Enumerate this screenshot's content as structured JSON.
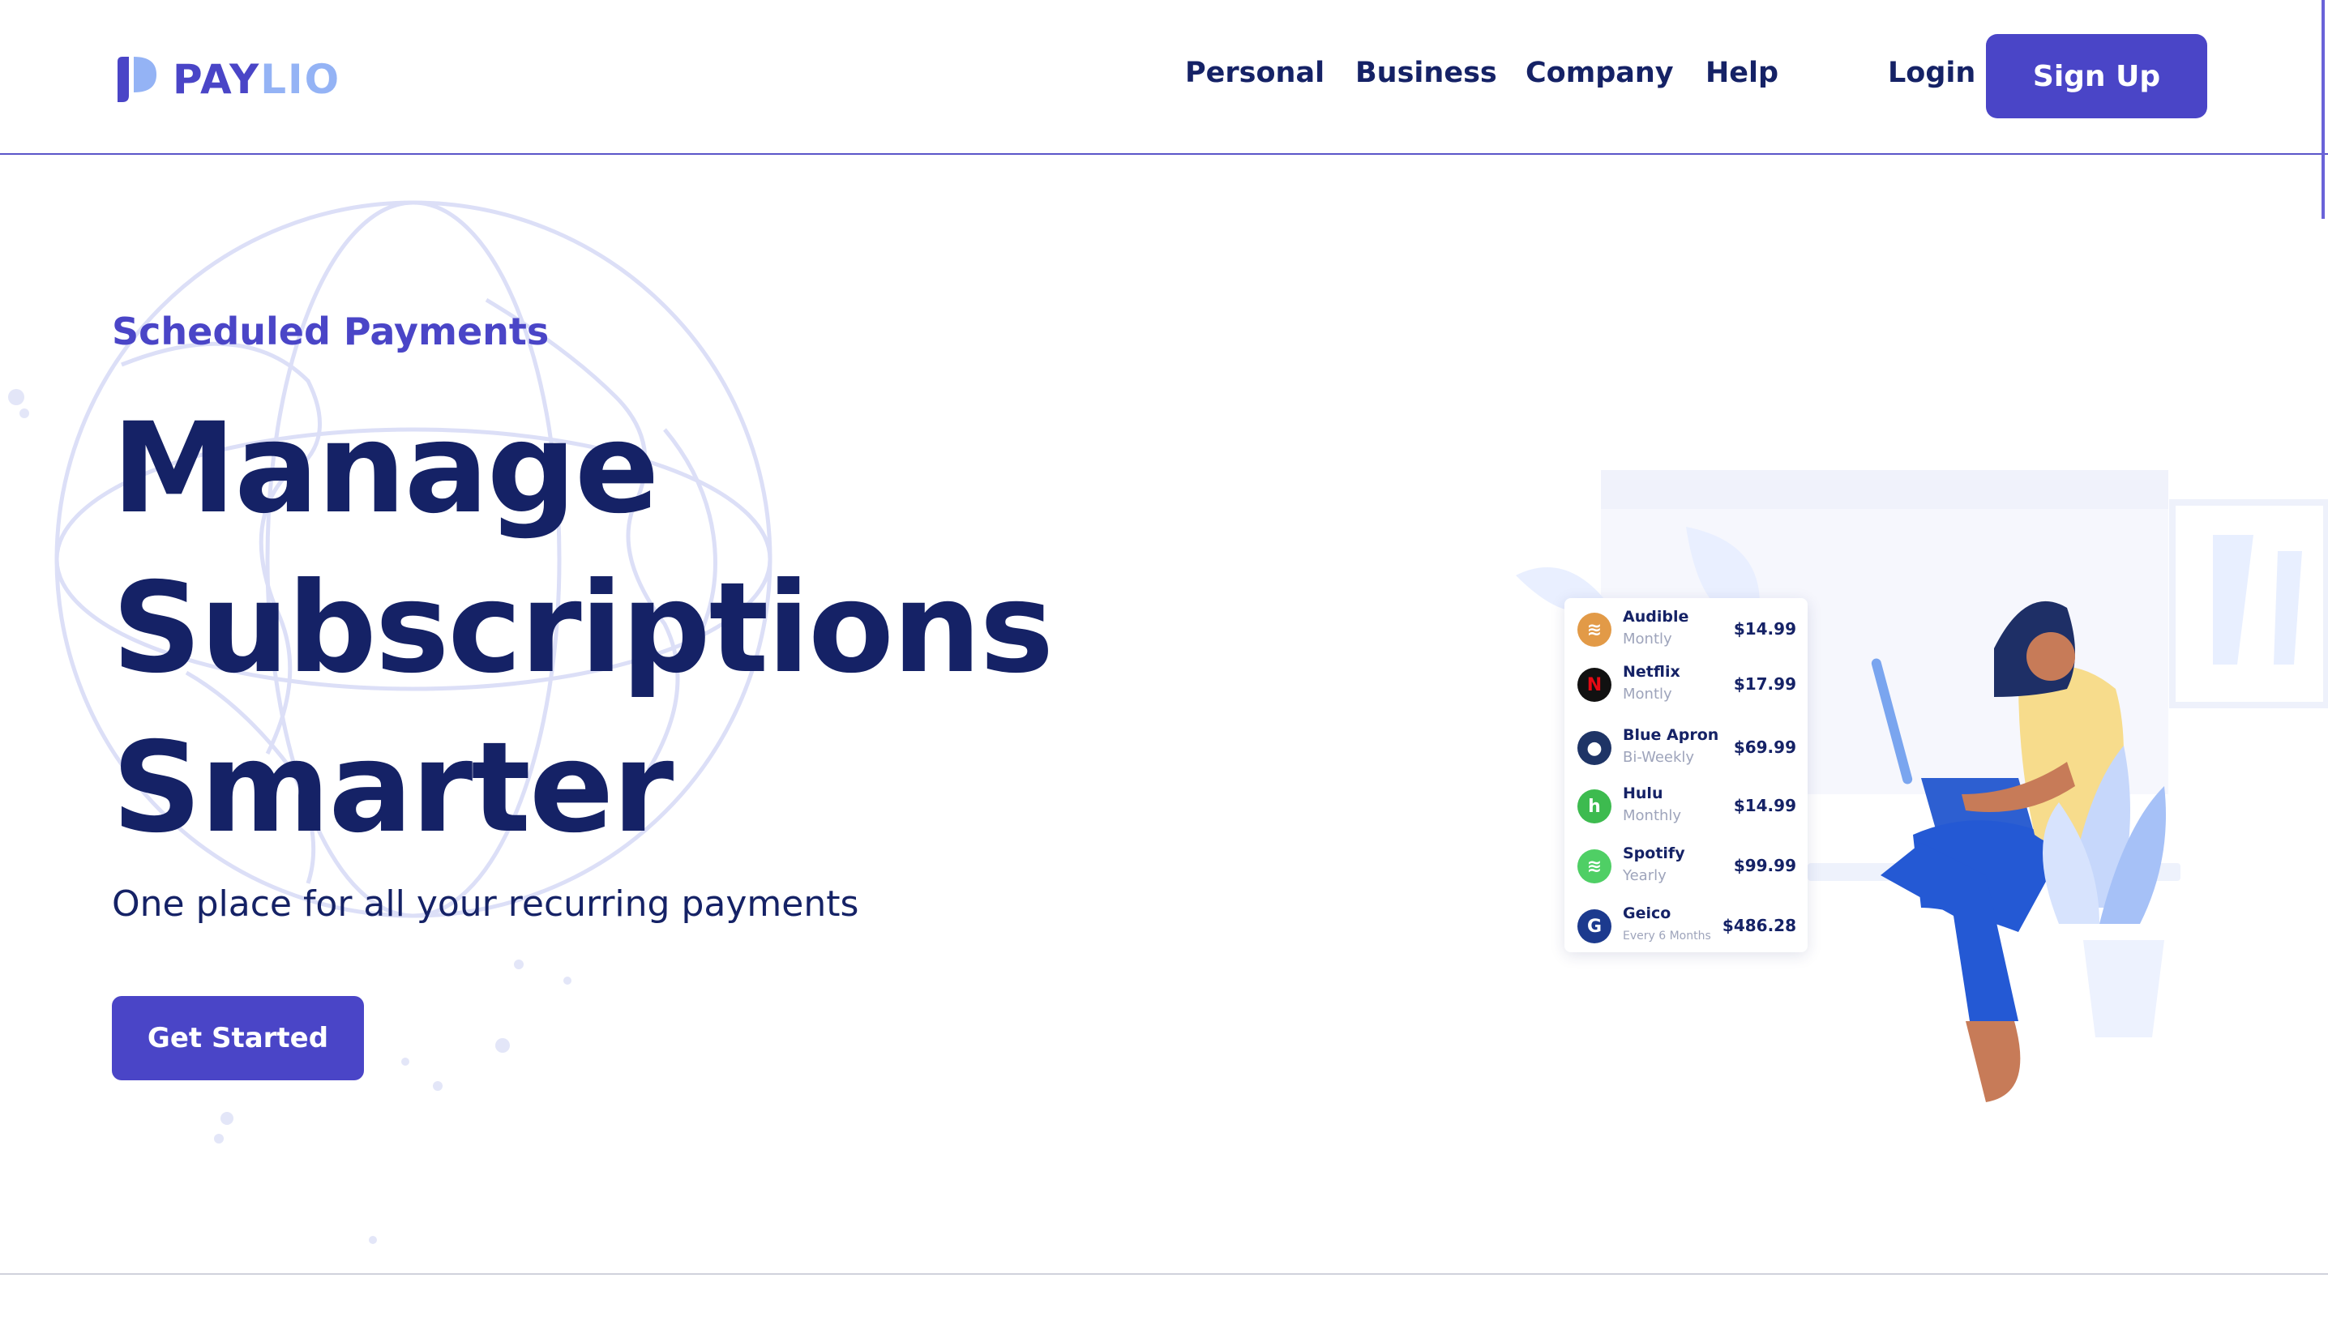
{
  "logo": {
    "part1": "PAY",
    "part2": "LIO"
  },
  "nav": {
    "personal": "Personal",
    "business": "Business",
    "company": "Company",
    "help": "Help",
    "login": "Login",
    "signup": "Sign Up"
  },
  "hero": {
    "eyebrow": "Scheduled Payments",
    "headline": [
      "Manage",
      "Subscriptions",
      "Smarter"
    ],
    "subhead": "One place for all your recurring payments",
    "cta": "Get Started"
  },
  "subscriptions": [
    {
      "name": "Audible",
      "frequency": "Montly",
      "price": "$14.99",
      "color": "#e29a47",
      "icon": "audible-icon",
      "glyph": "≋"
    },
    {
      "name": "Netflix",
      "frequency": "Montly",
      "price": "$17.99",
      "color": "#111111",
      "icon": "netflix-icon",
      "glyph": "N"
    },
    {
      "name": "Blue Apron",
      "frequency": "Bi-Weekly",
      "price": "$69.99",
      "color": "#1e3466",
      "icon": "blue-apron-icon",
      "glyph": "●"
    },
    {
      "name": "Hulu",
      "frequency": "Monthly",
      "price": "$14.99",
      "color": "#3dbb4f",
      "icon": "hulu-icon",
      "glyph": "h"
    },
    {
      "name": "Spotify",
      "frequency": "Yearly",
      "price": "$99.99",
      "color": "#4fcf65",
      "icon": "spotify-icon",
      "glyph": "≋"
    },
    {
      "name": "Geico",
      "frequency": "Every 6 Months",
      "price": "$486.28",
      "color": "#1c3a8e",
      "icon": "geico-icon",
      "glyph": "G"
    }
  ],
  "colors": {
    "brand": "#4a45c7",
    "brand_light": "#94b3f5",
    "navy": "#152266",
    "muted": "#9ea4bb"
  }
}
